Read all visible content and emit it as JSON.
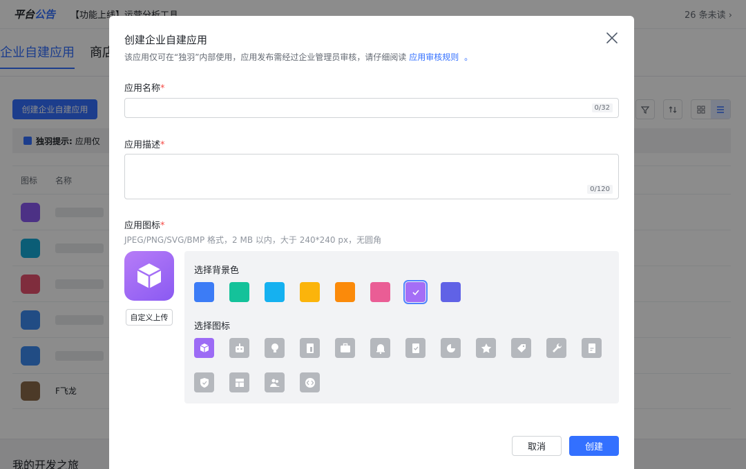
{
  "background": {
    "announce": {
      "title_a": "平台",
      "title_b": "公告",
      "text": "【功能上线】运营分析工具",
      "unread": "26 条未读 ›"
    },
    "tabs": [
      {
        "label": "企业自建应用"
      },
      {
        "label": "商店"
      }
    ],
    "create_button": "创建企业自建应用",
    "tip": {
      "bold": "独羽提示:",
      "text": "应用仅"
    },
    "table_headers": {
      "icon": "图标",
      "name": "名称"
    },
    "rows": [
      {
        "icon_color": "#8a5af2",
        "name": ""
      },
      {
        "icon_color": "#14a9d8",
        "name": ""
      },
      {
        "icon_color": "#e8526f",
        "name": ""
      },
      {
        "icon_color": "#3c8bf0",
        "name": ""
      },
      {
        "icon_color": "#3c8bf0",
        "name": ""
      },
      {
        "icon_color": "#8a6a4a",
        "name": "F飞龙"
      }
    ],
    "journey": "我的开发之旅"
  },
  "modal": {
    "title": "创建企业自建应用",
    "desc_text": "该应用仅可在“独羽”内部使用，应用发布需经过企业管理员审核，请仔细阅读",
    "desc_link": "应用审核规则",
    "desc_dot": "。",
    "name_field": {
      "label": "应用名称",
      "required_mark": "*",
      "value": "",
      "placeholder": "",
      "counter": "0/32"
    },
    "desc_field": {
      "label": "应用描述",
      "required_mark": "*",
      "value": "",
      "placeholder": "",
      "counter": "0/120"
    },
    "icon_field": {
      "label": "应用图标",
      "required_mark": "*",
      "hint": "JPEG/PNG/SVG/BMP 格式，2 MB 以内，大于 240*240 px，无圆角",
      "upload_label": "自定义上传"
    },
    "bg_color_title": "选择背景色",
    "bg_colors": [
      "#3c7cf6",
      "#14c29a",
      "#15b1f0",
      "#fbb40b",
      "#fb8a0a",
      "#ea5d95",
      "#a46ef6",
      "#6062e6"
    ],
    "selected_color_index": 6,
    "icon_title": "选择图标",
    "icons": [
      "cube-icon",
      "robot-icon",
      "lightbulb-icon",
      "document-icon",
      "briefcase-icon",
      "bell-icon",
      "checklist-icon",
      "pie-chart-icon",
      "star-icon",
      "tag-icon",
      "wrench-icon",
      "note-icon",
      "shield-icon",
      "layout-icon",
      "team-icon",
      "code-icon"
    ],
    "selected_icon_index": 0,
    "cancel_label": "取消",
    "create_label": "创建"
  }
}
